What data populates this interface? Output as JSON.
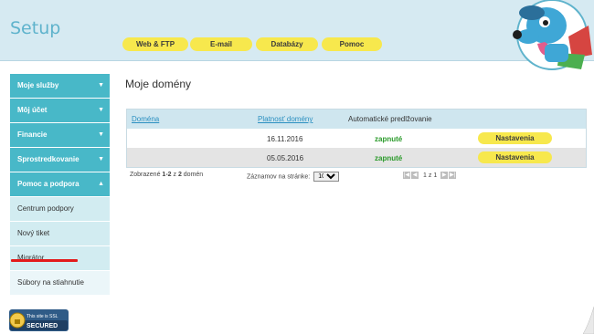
{
  "header": {
    "brand": "Setup"
  },
  "topnav": [
    {
      "label": "Web & FTP"
    },
    {
      "label": "E-mail"
    },
    {
      "label": "Databázy"
    },
    {
      "label": "Pomoc"
    }
  ],
  "sidebar": {
    "items": [
      {
        "label": "Moje služby",
        "arrow": "▼"
      },
      {
        "label": "Môj účet",
        "arrow": "▼"
      },
      {
        "label": "Financie",
        "arrow": "▼"
      },
      {
        "label": "Sprostredkovanie",
        "arrow": "▼"
      },
      {
        "label": "Pomoc a podpora",
        "arrow": "▲"
      }
    ],
    "subitems": [
      {
        "label": "Centrum podpory"
      },
      {
        "label": "Nový tiket"
      },
      {
        "label": "Migrátor"
      },
      {
        "label": "Súbory na stiahnutie"
      }
    ]
  },
  "ssl_badge": {
    "line1": "This site is SSL",
    "line2": "SECURED"
  },
  "main": {
    "title": "Moje domény",
    "table": {
      "headers": {
        "domain": "Doména",
        "validity": "Platnosť domény",
        "renewal": "Automatické predlžovanie"
      },
      "rows": [
        {
          "domain": "",
          "validity": "16.11.2016",
          "renewal": "zapnuté",
          "action": "Nastavenia"
        },
        {
          "domain": "",
          "validity": "05.05.2016",
          "renewal": "zapnuté",
          "action": "Nastavenia"
        }
      ]
    },
    "footer": {
      "shown_prefix": "Zobrazené ",
      "shown_range": "1-2",
      "shown_mid": " z ",
      "shown_total": "2",
      "shown_suffix": " domén",
      "per_page_label": "Záznamov na stránke:",
      "per_page_value": "10",
      "page_current": "1",
      "page_of": "z",
      "page_total": "1"
    }
  },
  "colors": {
    "accent": "#48b8c8",
    "button": "#f7e84d",
    "status_on": "#2a9a2a",
    "header_bg": "#d6eaf2"
  }
}
